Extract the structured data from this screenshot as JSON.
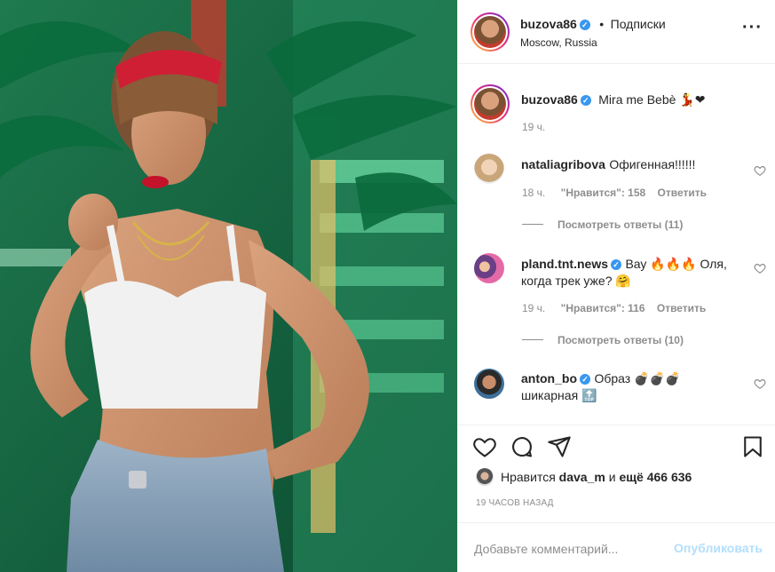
{
  "header": {
    "username": "buzova86",
    "separator": "•",
    "follow_label": "Подписки",
    "location": "Moscow, Russia",
    "more_label": "···"
  },
  "caption": {
    "username": "buzova86",
    "text": "Mira me Bebè 💃❤",
    "time": "19 ч."
  },
  "comments": [
    {
      "username": "nataliagribova",
      "text": "Офигенная!!!!!!",
      "time": "18 ч.",
      "likes": "\"Нравится\": 158",
      "reply": "Ответить",
      "view_replies": "Посмотреть ответы (11)"
    },
    {
      "username": "pland.tnt.news",
      "verified": true,
      "text": "Вау 🔥🔥🔥 Оля, когда трек уже? 🤗",
      "time": "19 ч.",
      "likes": "\"Нравится\": 116",
      "reply": "Ответить",
      "view_replies": "Посмотреть ответы (10)"
    },
    {
      "username": "anton_bo",
      "verified": true,
      "text": "Образ 💣💣💣 шикарная 🔝"
    }
  ],
  "actions": {
    "icons": [
      "heart-icon",
      "comment-icon",
      "share-icon",
      "bookmark-icon"
    ],
    "likes_prefix": "Нравится",
    "likes_user": "dava_m",
    "likes_mid": "и",
    "likes_count": "ещё 466 636",
    "posted": "19 ЧАСОВ НАЗАД"
  },
  "comment_input": {
    "placeholder": "Добавьте комментарий...",
    "publish_label": "Опубликовать"
  },
  "colors": {
    "accent": "#3897f0",
    "publish_disabled": "#b2dffc",
    "muted": "#8e8e8e"
  }
}
